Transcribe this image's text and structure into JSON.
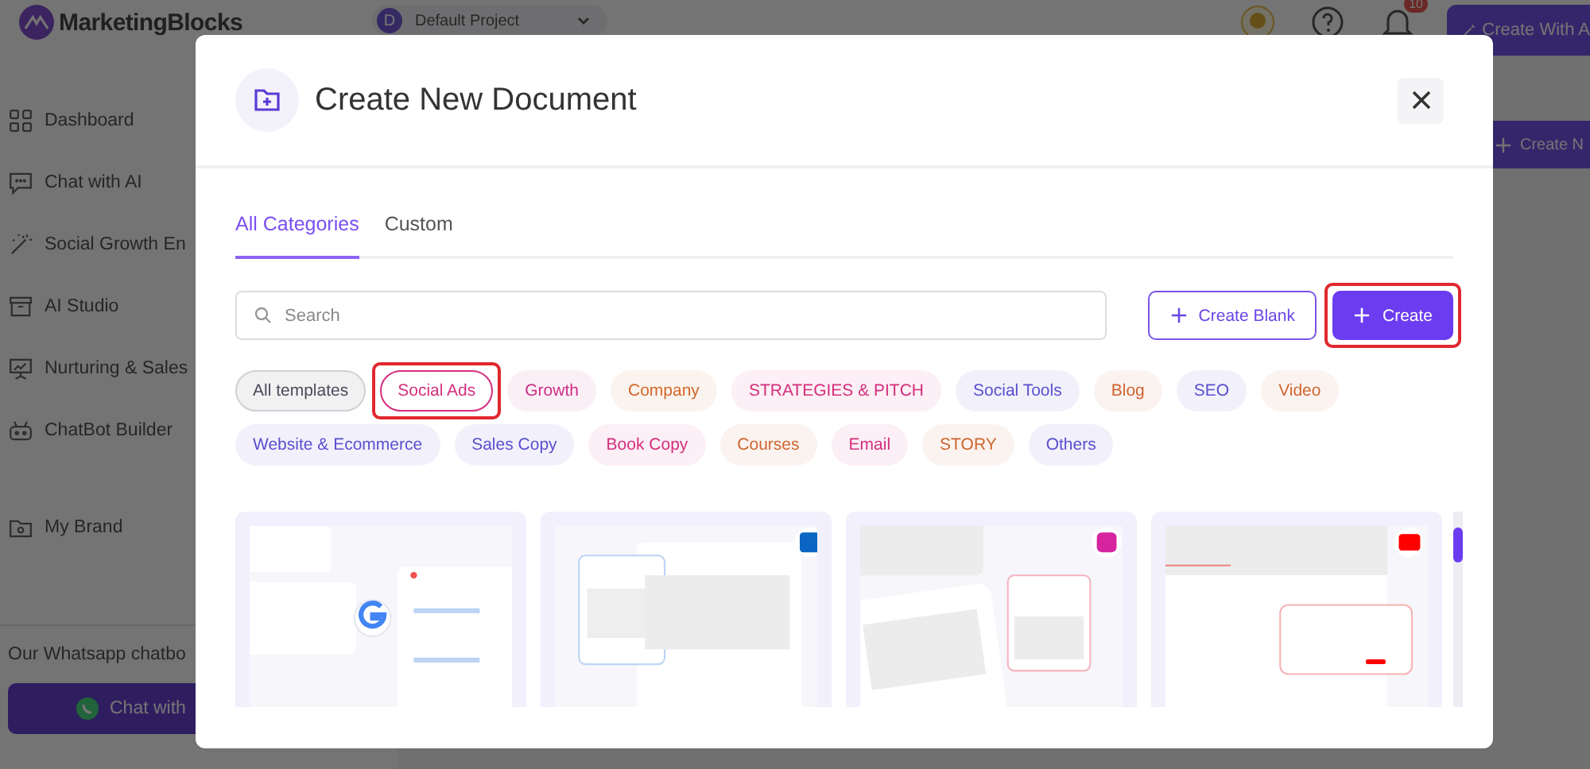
{
  "app": {
    "logo": "MarketingBlocks",
    "project": {
      "initial": "D",
      "name": "Default Project"
    },
    "notifications": "10",
    "create_ai_button": "Create With A",
    "sidebar": [
      {
        "label": "Dashboard"
      },
      {
        "label": "Chat with AI"
      },
      {
        "label": "Social Growth En"
      },
      {
        "label": "AI Studio"
      },
      {
        "label": "Nurturing & Sales"
      },
      {
        "label": "ChatBot Builder"
      },
      {
        "label": "My Brand"
      }
    ],
    "whatsapp": {
      "text": "Our Whatsapp chatbo",
      "button": "Chat with"
    },
    "create_new_button": "Create N"
  },
  "modal": {
    "title": "Create New Document",
    "tabs": [
      {
        "label": "All Categories",
        "selected": true
      },
      {
        "label": "Custom",
        "selected": false
      }
    ],
    "search": {
      "placeholder": "Search"
    },
    "buttons": [
      {
        "label": "Create Blank",
        "kind": "outline",
        "highlighted": false
      },
      {
        "label": "Create",
        "kind": "primary",
        "highlighted": true
      }
    ],
    "chips": [
      {
        "label": "All templates",
        "color": "#4a4a5a",
        "selected": false,
        "highlighted": false
      },
      {
        "label": "Social Ads",
        "color": "#d42f7e",
        "selected": true,
        "highlighted": true
      },
      {
        "label": "Growth",
        "color": "#cc2f86",
        "selected": false,
        "highlighted": false
      },
      {
        "label": "Company",
        "color": "#d2692b",
        "selected": false,
        "highlighted": false
      },
      {
        "label": "STRATEGIES & PITCH",
        "color": "#d42f7e",
        "selected": false,
        "highlighted": false
      },
      {
        "label": "Social Tools",
        "color": "#5a4fcf",
        "selected": false,
        "highlighted": false
      },
      {
        "label": "Blog",
        "color": "#cf6530",
        "selected": false,
        "highlighted": false
      },
      {
        "label": "SEO",
        "color": "#5a4fcf",
        "selected": false,
        "highlighted": false
      },
      {
        "label": "Video",
        "color": "#cf6530",
        "selected": false,
        "highlighted": false
      },
      {
        "label": "Website & Ecommerce",
        "color": "#5a4fcf",
        "selected": false,
        "highlighted": false
      },
      {
        "label": "Sales Copy",
        "color": "#5a4fcf",
        "selected": false,
        "highlighted": false
      },
      {
        "label": "Book Copy",
        "color": "#d42f7e",
        "selected": false,
        "highlighted": false
      },
      {
        "label": "Courses",
        "color": "#cf6530",
        "selected": false,
        "highlighted": false
      },
      {
        "label": "Email",
        "color": "#d42f7e",
        "selected": false,
        "highlighted": false
      },
      {
        "label": "STORY",
        "color": "#cf6530",
        "selected": false,
        "highlighted": false
      },
      {
        "label": "Others",
        "color": "#5a4fcf",
        "selected": false,
        "highlighted": false
      }
    ]
  }
}
